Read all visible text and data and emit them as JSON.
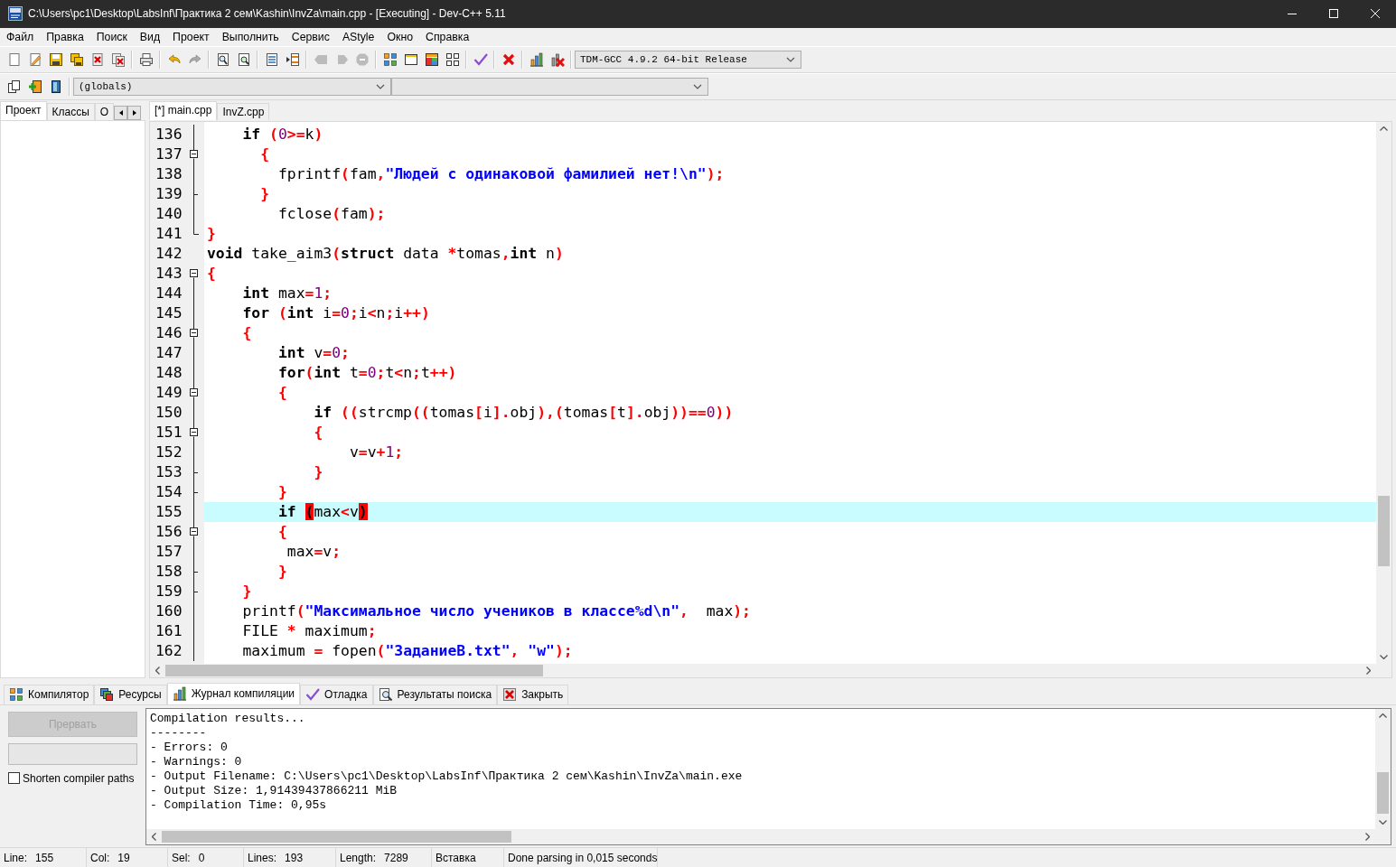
{
  "window": {
    "title": "C:\\Users\\pc1\\Desktop\\LabsInf\\Практика 2 сем\\Kashin\\InvZa\\main.cpp - [Executing] - Dev-C++ 5.11"
  },
  "menu": [
    "Файл",
    "Правка",
    "Поиск",
    "Вид",
    "Проект",
    "Выполнить",
    "Сервис",
    "AStyle",
    "Окно",
    "Справка"
  ],
  "toolbar": {
    "compiler": "TDM-GCC 4.9.2 64-bit Release",
    "scope": "(globals)"
  },
  "side_panel": {
    "tabs": [
      {
        "label": "Проект",
        "selected": true
      },
      {
        "label": "Классы",
        "selected": false
      },
      {
        "label": "О",
        "selected": false
      }
    ]
  },
  "editor": {
    "tabs": [
      {
        "label": "[*] main.cpp",
        "selected": true
      },
      {
        "label": "InvZ.cpp",
        "selected": false
      }
    ],
    "lines": [
      {
        "number": "136",
        "kind": "line",
        "current": false,
        "tokens": [
          {
            "kind": "keyword",
            "text": "    if"
          },
          {
            "kind": "symbol",
            "text": " ("
          },
          {
            "kind": "number",
            "text": "0"
          },
          {
            "kind": "symbol",
            "text": ">="
          },
          {
            "kind": "plain",
            "text": "k"
          },
          {
            "kind": "symbol",
            "text": ")"
          }
        ]
      },
      {
        "number": "137",
        "kind": "open",
        "current": false,
        "tokens": [
          {
            "kind": "symbol",
            "text": "      {"
          }
        ]
      },
      {
        "number": "138",
        "kind": "line",
        "current": false,
        "tokens": [
          {
            "kind": "plain",
            "text": "        fprintf"
          },
          {
            "kind": "symbol",
            "text": "("
          },
          {
            "kind": "plain",
            "text": "fam"
          },
          {
            "kind": "symbol",
            "text": ","
          },
          {
            "kind": "string",
            "text": "\"Людей с одинаковой фамилией нет!\\n\""
          },
          {
            "kind": "symbol",
            "text": ");"
          }
        ]
      },
      {
        "number": "139",
        "kind": "tick",
        "current": false,
        "tokens": [
          {
            "kind": "symbol",
            "text": "      }"
          }
        ]
      },
      {
        "number": "140",
        "kind": "line",
        "current": false,
        "tokens": [
          {
            "kind": "plain",
            "text": "        fclose"
          },
          {
            "kind": "symbol",
            "text": "("
          },
          {
            "kind": "plain",
            "text": "fam"
          },
          {
            "kind": "symbol",
            "text": ");"
          }
        ]
      },
      {
        "number": "141",
        "kind": "end",
        "current": false,
        "tokens": [
          {
            "kind": "symbol",
            "text": "}"
          }
        ]
      },
      {
        "number": "142",
        "kind": "none",
        "current": false,
        "tokens": [
          {
            "kind": "keyword",
            "text": "void"
          },
          {
            "kind": "plain",
            "text": " take_aim3"
          },
          {
            "kind": "symbol",
            "text": "("
          },
          {
            "kind": "keyword",
            "text": "struct"
          },
          {
            "kind": "plain",
            "text": " data "
          },
          {
            "kind": "symbol",
            "text": "*"
          },
          {
            "kind": "plain",
            "text": "tomas"
          },
          {
            "kind": "symbol",
            "text": ","
          },
          {
            "kind": "keyword",
            "text": "int"
          },
          {
            "kind": "plain",
            "text": " n"
          },
          {
            "kind": "symbol",
            "text": ")"
          }
        ]
      },
      {
        "number": "143",
        "kind": "start",
        "current": false,
        "tokens": [
          {
            "kind": "symbol",
            "text": "{"
          }
        ]
      },
      {
        "number": "144",
        "kind": "line",
        "current": false,
        "tokens": [
          {
            "kind": "keyword",
            "text": "    int"
          },
          {
            "kind": "plain",
            "text": " max"
          },
          {
            "kind": "symbol",
            "text": "="
          },
          {
            "kind": "number",
            "text": "1"
          },
          {
            "kind": "symbol",
            "text": ";"
          }
        ]
      },
      {
        "number": "145",
        "kind": "line",
        "current": false,
        "tokens": [
          {
            "kind": "keyword",
            "text": "    for"
          },
          {
            "kind": "symbol",
            "text": " ("
          },
          {
            "kind": "keyword",
            "text": "int"
          },
          {
            "kind": "plain",
            "text": " i"
          },
          {
            "kind": "symbol",
            "text": "="
          },
          {
            "kind": "number",
            "text": "0"
          },
          {
            "kind": "symbol",
            "text": ";"
          },
          {
            "kind": "plain",
            "text": "i"
          },
          {
            "kind": "symbol",
            "text": "<"
          },
          {
            "kind": "plain",
            "text": "n"
          },
          {
            "kind": "symbol",
            "text": ";"
          },
          {
            "kind": "plain",
            "text": "i"
          },
          {
            "kind": "symbol",
            "text": "++)"
          }
        ]
      },
      {
        "number": "146",
        "kind": "open",
        "current": false,
        "tokens": [
          {
            "kind": "symbol",
            "text": "    {"
          }
        ]
      },
      {
        "number": "147",
        "kind": "line",
        "current": false,
        "tokens": [
          {
            "kind": "keyword",
            "text": "        int"
          },
          {
            "kind": "plain",
            "text": " v"
          },
          {
            "kind": "symbol",
            "text": "="
          },
          {
            "kind": "number",
            "text": "0"
          },
          {
            "kind": "symbol",
            "text": ";"
          }
        ]
      },
      {
        "number": "148",
        "kind": "line",
        "current": false,
        "tokens": [
          {
            "kind": "keyword",
            "text": "        for"
          },
          {
            "kind": "symbol",
            "text": "("
          },
          {
            "kind": "keyword",
            "text": "int"
          },
          {
            "kind": "plain",
            "text": " t"
          },
          {
            "kind": "symbol",
            "text": "="
          },
          {
            "kind": "number",
            "text": "0"
          },
          {
            "kind": "symbol",
            "text": ";"
          },
          {
            "kind": "plain",
            "text": "t"
          },
          {
            "kind": "symbol",
            "text": "<"
          },
          {
            "kind": "plain",
            "text": "n"
          },
          {
            "kind": "symbol",
            "text": ";"
          },
          {
            "kind": "plain",
            "text": "t"
          },
          {
            "kind": "symbol",
            "text": "++)"
          }
        ]
      },
      {
        "number": "149",
        "kind": "open",
        "current": false,
        "tokens": [
          {
            "kind": "symbol",
            "text": "        {"
          }
        ]
      },
      {
        "number": "150",
        "kind": "line",
        "current": false,
        "tokens": [
          {
            "kind": "keyword",
            "text": "            if"
          },
          {
            "kind": "symbol",
            "text": " (("
          },
          {
            "kind": "plain",
            "text": "strcmp"
          },
          {
            "kind": "symbol",
            "text": "(("
          },
          {
            "kind": "plain",
            "text": "tomas"
          },
          {
            "kind": "symbol",
            "text": "["
          },
          {
            "kind": "plain",
            "text": "i"
          },
          {
            "kind": "symbol",
            "text": "]."
          },
          {
            "kind": "plain",
            "text": "obj"
          },
          {
            "kind": "symbol",
            "text": "),("
          },
          {
            "kind": "plain",
            "text": "tomas"
          },
          {
            "kind": "symbol",
            "text": "["
          },
          {
            "kind": "plain",
            "text": "t"
          },
          {
            "kind": "symbol",
            "text": "]."
          },
          {
            "kind": "plain",
            "text": "obj"
          },
          {
            "kind": "symbol",
            "text": "))=="
          },
          {
            "kind": "number",
            "text": "0"
          },
          {
            "kind": "symbol",
            "text": "))"
          }
        ]
      },
      {
        "number": "151",
        "kind": "open",
        "current": false,
        "tokens": [
          {
            "kind": "symbol",
            "text": "            {"
          }
        ]
      },
      {
        "number": "152",
        "kind": "line",
        "current": false,
        "tokens": [
          {
            "kind": "plain",
            "text": "                v"
          },
          {
            "kind": "symbol",
            "text": "="
          },
          {
            "kind": "plain",
            "text": "v"
          },
          {
            "kind": "symbol",
            "text": "+"
          },
          {
            "kind": "number",
            "text": "1"
          },
          {
            "kind": "symbol",
            "text": ";"
          }
        ]
      },
      {
        "number": "153",
        "kind": "tick",
        "current": false,
        "tokens": [
          {
            "kind": "symbol",
            "text": "            }"
          }
        ]
      },
      {
        "number": "154",
        "kind": "tick",
        "current": false,
        "tokens": [
          {
            "kind": "symbol",
            "text": "        }"
          }
        ]
      },
      {
        "number": "155",
        "kind": "line",
        "current": true,
        "tokens": [
          {
            "kind": "keyword",
            "text": "        if "
          },
          {
            "kind": "match",
            "text": "("
          },
          {
            "kind": "plain",
            "text": "max"
          },
          {
            "kind": "symbol",
            "text": "<"
          },
          {
            "kind": "plain",
            "text": "v"
          },
          {
            "kind": "match",
            "text": ")"
          }
        ]
      },
      {
        "number": "156",
        "kind": "open",
        "current": false,
        "tokens": [
          {
            "kind": "symbol",
            "text": "        {"
          }
        ]
      },
      {
        "number": "157",
        "kind": "line",
        "current": false,
        "tokens": [
          {
            "kind": "plain",
            "text": "         max"
          },
          {
            "kind": "symbol",
            "text": "="
          },
          {
            "kind": "plain",
            "text": "v"
          },
          {
            "kind": "symbol",
            "text": ";"
          }
        ]
      },
      {
        "number": "158",
        "kind": "tick",
        "current": false,
        "tokens": [
          {
            "kind": "symbol",
            "text": "        }"
          }
        ]
      },
      {
        "number": "159",
        "kind": "tick",
        "current": false,
        "tokens": [
          {
            "kind": "symbol",
            "text": "    }"
          }
        ]
      },
      {
        "number": "160",
        "kind": "line",
        "current": false,
        "tokens": [
          {
            "kind": "plain",
            "text": "    printf"
          },
          {
            "kind": "symbol",
            "text": "("
          },
          {
            "kind": "string",
            "text": "\"Максимальное число учеников в классе%d\\n\""
          },
          {
            "kind": "symbol",
            "text": ","
          },
          {
            "kind": "plain",
            "text": "  max"
          },
          {
            "kind": "symbol",
            "text": ");"
          }
        ]
      },
      {
        "number": "161",
        "kind": "line",
        "current": false,
        "tokens": [
          {
            "kind": "plain",
            "text": "    FILE "
          },
          {
            "kind": "symbol",
            "text": "*"
          },
          {
            "kind": "plain",
            "text": " maximum"
          },
          {
            "kind": "symbol",
            "text": ";"
          }
        ]
      },
      {
        "number": "162",
        "kind": "line",
        "current": false,
        "tokens": [
          {
            "kind": "plain",
            "text": "    maximum "
          },
          {
            "kind": "symbol",
            "text": "="
          },
          {
            "kind": "plain",
            "text": " fopen"
          },
          {
            "kind": "symbol",
            "text": "("
          },
          {
            "kind": "string",
            "text": "\"ЗаданиеB.txt\""
          },
          {
            "kind": "symbol",
            "text": ", "
          },
          {
            "kind": "string",
            "text": "\"w\""
          },
          {
            "kind": "symbol",
            "text": ");"
          }
        ]
      }
    ]
  },
  "bottom_panel": {
    "tabs": [
      {
        "label": "Компилятор",
        "selected": false
      },
      {
        "label": "Ресурсы",
        "selected": false
      },
      {
        "label": "Журнал компиляции",
        "selected": true
      },
      {
        "label": "Отладка",
        "selected": false
      },
      {
        "label": "Результаты поиска",
        "selected": false
      },
      {
        "label": "Закрыть",
        "selected": false
      }
    ],
    "abort_button": {
      "label": "Прервать",
      "disabled": true
    },
    "progress": {
      "level": 0
    },
    "shorten_paths": {
      "label": "Shorten compiler paths",
      "checked": false
    },
    "log": [
      "Compilation results...",
      "--------",
      "- Errors: 0",
      "- Warnings: 0",
      "- Output Filename: C:\\Users\\pc1\\Desktop\\LabsInf\\Практика 2 сем\\Kashin\\InvZa\\main.exe",
      "- Output Size: 1,91439437866211 MiB",
      "- Compilation Time: 0,95s"
    ]
  },
  "status_bar": [
    {
      "label": "Line:",
      "value": "155"
    },
    {
      "label": "Col:",
      "value": "19"
    },
    {
      "label": "Sel:",
      "value": "0"
    },
    {
      "label": "Lines:",
      "value": "193"
    },
    {
      "label": "Length:",
      "value": "7289"
    },
    {
      "label": "Вставка"
    },
    {
      "label": "Done parsing in 0,015 seconds"
    }
  ]
}
